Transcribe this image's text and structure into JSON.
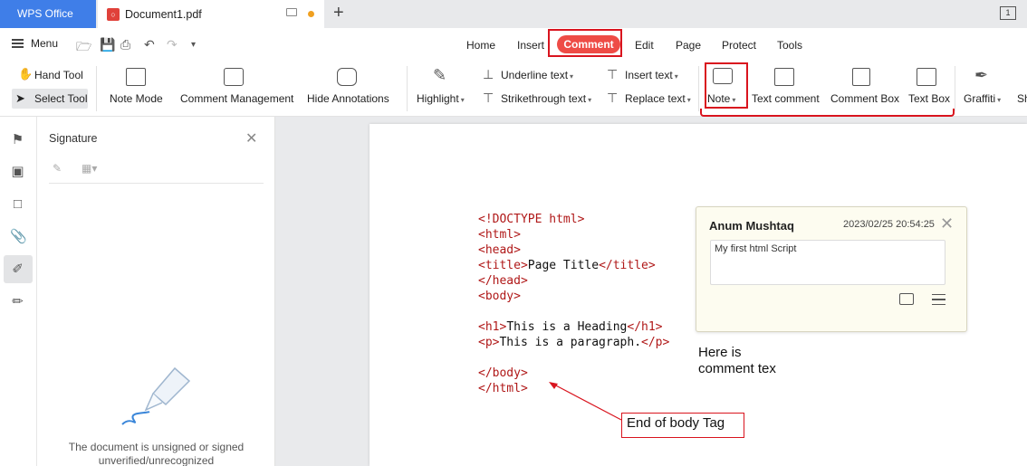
{
  "tabbar": {
    "app_name": "WPS Office",
    "doc_tab_title": "Document1.pdf",
    "new_tab": "+",
    "window_count": "1"
  },
  "menu": {
    "menu_label": "Menu",
    "tabs": [
      "Home",
      "Insert",
      "Comment",
      "Edit",
      "Page",
      "Protect",
      "Tools"
    ],
    "active_tab": "Comment",
    "highlight_color": "#d9141e",
    "active_tab_color": "#ee4c46"
  },
  "ribbon": {
    "hand_tool": "Hand Tool",
    "select_tool": "Select Tool",
    "note_mode": "Note Mode",
    "comment_management": "Comment Management",
    "hide_annotations": "Hide Annotations",
    "highlight": "Highlight",
    "underline_text": "Underline text",
    "strikethrough_text": "Strikethrough text",
    "insert_text": "Insert text",
    "replace_text": "Replace text",
    "note": "Note",
    "text_comment": "Text comment",
    "comment_box": "Comment Box",
    "text_box": "Text Box",
    "graffiti": "Graffiti",
    "shape": "Sh"
  },
  "signature_panel": {
    "title": "Signature",
    "message_line1": "The document is unsigned or signed",
    "message_line2": "unverified/unrecognized"
  },
  "document": {
    "code_lines": [
      {
        "parts": [
          [
            "t",
            "<!DOCTYPE html>"
          ]
        ]
      },
      {
        "parts": [
          [
            "t",
            "<html>"
          ]
        ]
      },
      {
        "parts": [
          [
            "t",
            "<head>"
          ]
        ]
      },
      {
        "parts": [
          [
            "t",
            "<title>"
          ],
          [
            "x",
            "Page Title"
          ],
          [
            "t",
            "</title>"
          ]
        ]
      },
      {
        "parts": [
          [
            "t",
            "</head>"
          ]
        ]
      },
      {
        "parts": [
          [
            "t",
            "<body>"
          ]
        ]
      },
      {
        "parts": []
      },
      {
        "parts": [
          [
            "t",
            "<h1>"
          ],
          [
            "x",
            "This is a Heading"
          ],
          [
            "t",
            "</h1>"
          ]
        ]
      },
      {
        "parts": [
          [
            "t",
            "<p>"
          ],
          [
            "x",
            "This is a paragraph."
          ],
          [
            "t",
            "</p>"
          ]
        ]
      },
      {
        "parts": []
      },
      {
        "parts": [
          [
            "t",
            "</body>"
          ]
        ]
      },
      {
        "parts": [
          [
            "t",
            "</html>"
          ]
        ]
      }
    ],
    "note": {
      "author": "Anum Mushtaq",
      "timestamp": "2023/02/25 20:54:25",
      "body": "My first html Script"
    },
    "note_caption_line1": "Here is",
    "note_caption_line2": "comment tex",
    "end_label": "End of body Tag"
  }
}
